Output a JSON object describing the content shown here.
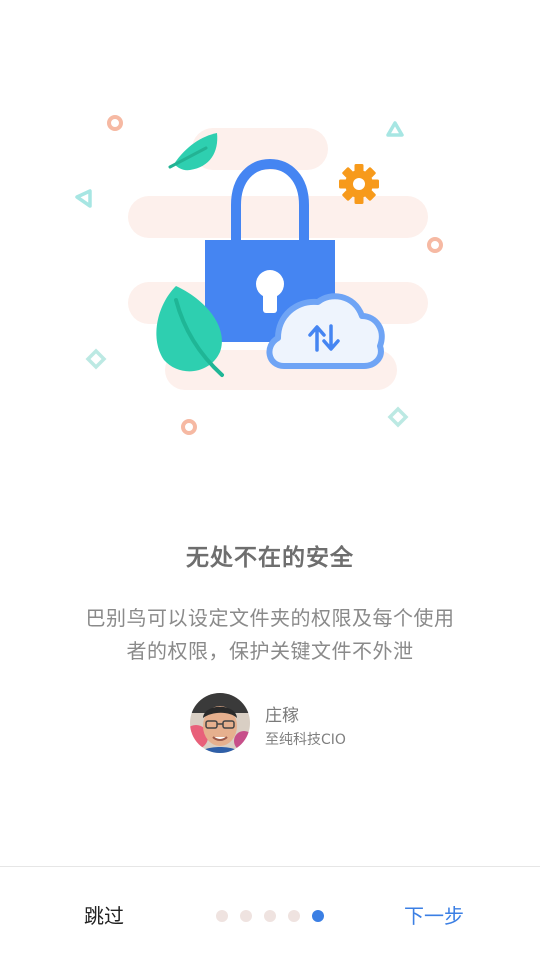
{
  "onboarding": {
    "title": "无处不在的安全",
    "description_line1": "巴别鸟可以设定文件夹的权限及每个使用",
    "description_line2": "者的权限，保护关键文件不外泄"
  },
  "testimonial": {
    "name": "庄稼",
    "role": "至纯科技CIO",
    "avatar_icon": "person-avatar"
  },
  "footer": {
    "skip_label": "跳过",
    "next_label": "下一步",
    "page_count": 5,
    "current_page": 5
  },
  "illustration": {
    "icons": [
      "lock-icon",
      "cloud-sync-icon",
      "gear-icon",
      "leaf-icon"
    ]
  },
  "colors": {
    "accent": "#3b7fe4",
    "lock": "#4585f2",
    "leaf": "#2ecfb0",
    "gear": "#f79a1b",
    "blob": "#fdf0ec",
    "dot_inactive": "#efe3e0"
  }
}
